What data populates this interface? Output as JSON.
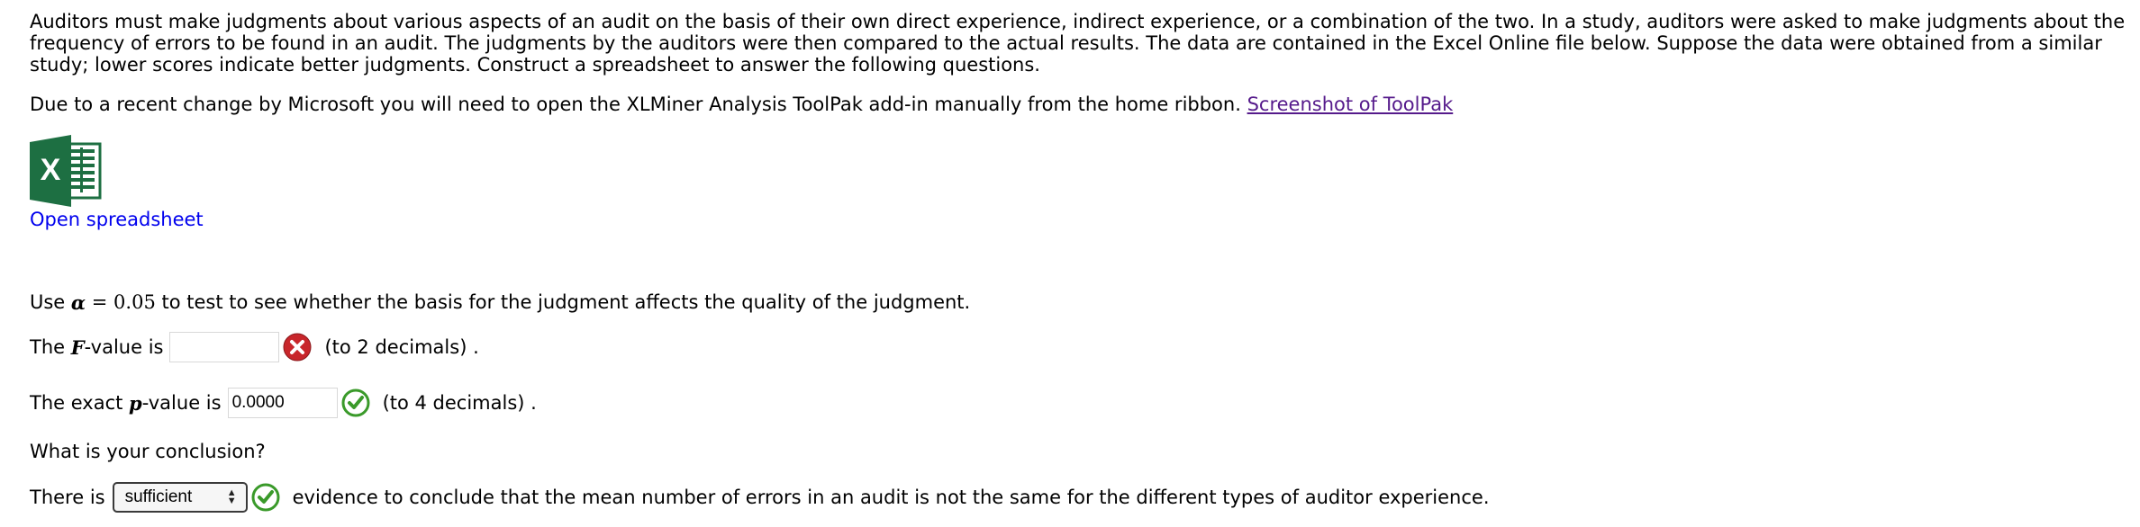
{
  "intro_text": "Auditors must make judgments about various aspects of an audit on the basis of their own direct experience, indirect experience, or a combination of the two. In a study, auditors were asked to make judgments about the frequency of errors to be found in an audit. The judgments by the auditors were then compared to the actual results. The data are contained in the Excel Online file below. Suppose the data were obtained from a similar study; lower scores indicate better judgments. Construct a spreadsheet to answer the following questions.",
  "toolpak": {
    "text": "Due to a recent change by Microsoft you will need to open the XLMiner Analysis ToolPak add-in manually from the home ribbon. ",
    "link_label": "Screenshot of ToolPak"
  },
  "spreadsheet": {
    "icon": "excel-icon",
    "link_label": "Open spreadsheet"
  },
  "alpha_row": {
    "prefix": "Use ",
    "symbol": "α",
    "equals": " = ",
    "value": "0.05",
    "suffix": " to test to see whether the basis for the judgment affects the quality of the judgment."
  },
  "f_value": {
    "prefix": "The ",
    "symbol": "F",
    "label": "-value is",
    "value": "",
    "status": "incorrect",
    "status_icon": "error-x-icon",
    "note": "(to 2 decimals) ."
  },
  "p_value": {
    "prefix": "The exact ",
    "symbol": "p",
    "label": "-value is",
    "value": "0.0000",
    "status": "correct",
    "status_icon": "check-icon",
    "note": "(to 4 decimals) ."
  },
  "conclusion_question": "What is your conclusion?",
  "conclusion": {
    "prefix": "There is",
    "selected": "sufficient",
    "status": "correct",
    "status_icon": "check-icon",
    "suffix": "evidence to conclude that the mean number of errors in an audit is not the same for the different types of auditor experience."
  },
  "colors": {
    "link_visited": "#551a8b",
    "link": "#0000ee",
    "excel_green": "#1d6f42",
    "correct_green": "#3a9a2a",
    "incorrect_red": "#c8262b"
  }
}
